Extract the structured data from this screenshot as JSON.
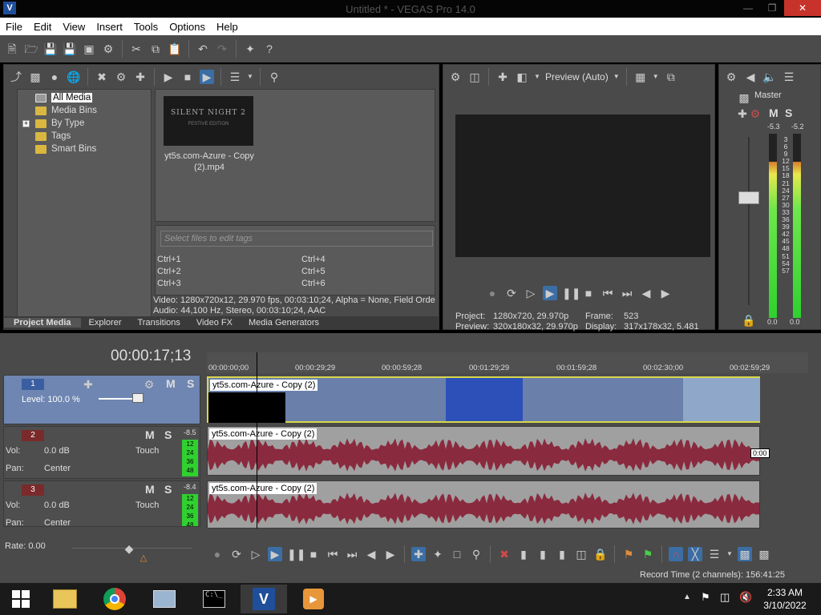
{
  "window": {
    "title": "Untitled * - VEGAS Pro 14.0",
    "app_icon": "V"
  },
  "menu": [
    "File",
    "Edit",
    "View",
    "Insert",
    "Tools",
    "Options",
    "Help"
  ],
  "media": {
    "tree": [
      "All Media",
      "Media Bins",
      "By Type",
      "Tags",
      "Smart Bins"
    ],
    "thumb_title": "SILENT NIGHT 2",
    "thumb_sub": "FESTIVE EDITION",
    "file_name": "yt5s.com-Azure - Copy (2).mp4",
    "tag_placeholder": "Select files to edit tags",
    "ctrl": [
      "Ctrl+1",
      "Ctrl+4",
      "Ctrl+2",
      "Ctrl+5",
      "Ctrl+3",
      "Ctrl+6"
    ],
    "info_video": "Video: 1280x720x12, 29.970 fps, 00:03:10;24, Alpha = None, Field Orde",
    "info_audio": "Audio: 44,100 Hz, Stereo, 00:03:10;24, AAC",
    "tabs": [
      "Project Media",
      "Explorer",
      "Transitions",
      "Video FX",
      "Media Generators"
    ]
  },
  "preview": {
    "mode": "Preview (Auto)",
    "project_label": "Project:",
    "project_value": "1280x720, 29.970p",
    "preview_label": "Preview:",
    "preview_value": "320x180x32, 29.970p",
    "frame_label": "Frame:",
    "frame_value": "523",
    "display_label": "Display:",
    "display_value": "317x178x32, 5.481"
  },
  "master": {
    "title": "Master",
    "left_peak": "-5.3",
    "right_peak": "-5.2",
    "scale": [
      "3",
      "6",
      "9",
      "12",
      "15",
      "18",
      "21",
      "24",
      "27",
      "30",
      "33",
      "36",
      "39",
      "42",
      "45",
      "48",
      "51",
      "54",
      "57"
    ],
    "left_level": "0.0",
    "right_level": "0.0",
    "mute": "M",
    "solo": "S"
  },
  "timeline": {
    "timecode": "00:00:17;13",
    "ruler": [
      "00:00:00;00",
      "00:00:29;29",
      "00:00:59;28",
      "00:01:29;29",
      "00:01:59;28",
      "00:02:30;00",
      "00:02:59;29"
    ],
    "video_track": {
      "num": "1",
      "level": "Level: 100.0 %"
    },
    "audio1": {
      "num": "2",
      "vol_label": "Vol:",
      "vol_value": "0.0 dB",
      "pan_label": "Pan:",
      "pan_value": "Center",
      "peak": "-8.5",
      "mode": "Touch",
      "meter": [
        "12",
        "24",
        "36",
        "48"
      ]
    },
    "audio2": {
      "num": "3",
      "vol_label": "Vol:",
      "vol_value": "0.0 dB",
      "pan_label": "Pan:",
      "pan_value": "Center",
      "peak": "-8.4",
      "mode": "Touch",
      "meter": [
        "12",
        "24",
        "36",
        "48"
      ]
    },
    "clip_name": "yt5s.com-Azure - Copy (2)",
    "clip_end_time": "0:00",
    "rate": "Rate: 0.00",
    "m": "M",
    "s": "S"
  },
  "status": {
    "record_time": "Record Time (2 channels): 156:41:25"
  },
  "taskbar": {
    "time": "2:33 AM",
    "date": "3/10/2022"
  }
}
